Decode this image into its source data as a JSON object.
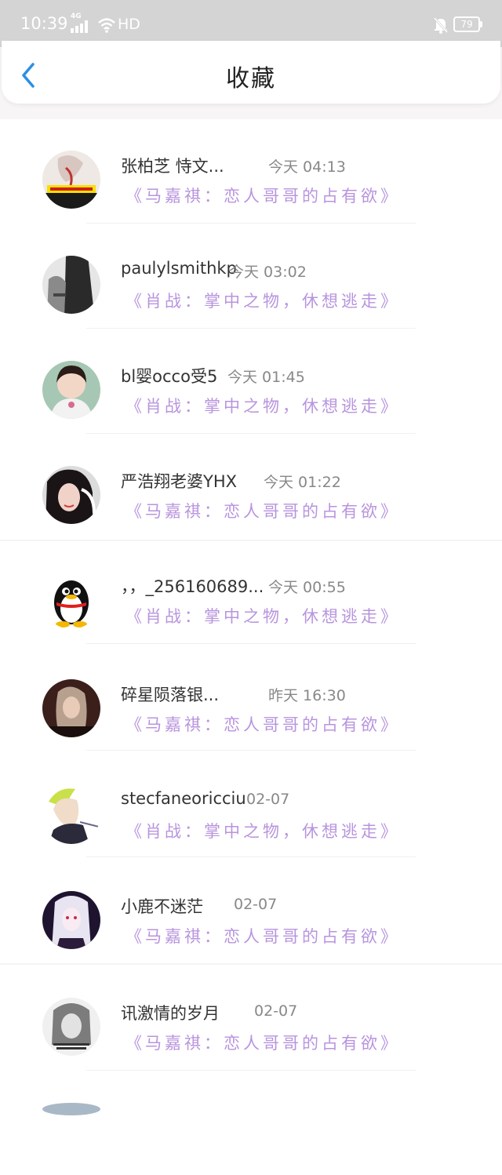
{
  "status": {
    "time": "10:39",
    "network": "4G",
    "hd": "HD",
    "battery": "79"
  },
  "header": {
    "title": "收藏"
  },
  "favorites": [
    {
      "user": "张柏芝 恃文...",
      "time": "今天 04:13",
      "title": "《马嘉祺：恋人哥哥的占有欲》"
    },
    {
      "user": "paulylsmithkp",
      "time": "今天 03:02",
      "title": "《肖战：掌中之物，休想逃走》"
    },
    {
      "user": "bl婴occo受5",
      "time": "今天 01:45",
      "title": "《肖战：掌中之物，休想逃走》"
    },
    {
      "user": "严浩翔老婆YHX",
      "time": "今天 01:22",
      "title": "《马嘉祺：恋人哥哥的占有欲》"
    },
    {
      "user": "，，_256160689...",
      "time": "今天 00:55",
      "title": "《肖战：掌中之物，休想逃走》"
    },
    {
      "user": "碎星陨落银...",
      "time": "昨天 16:30",
      "title": "《马嘉祺：恋人哥哥的占有欲》"
    },
    {
      "user": "stecfaneoricciu",
      "time": "02-07",
      "title": "《肖战：掌中之物，休想逃走》"
    },
    {
      "user": "小鹿不迷茫",
      "time": "02-07",
      "title": "《马嘉祺：恋人哥哥的占有欲》"
    },
    {
      "user": "讯激情的岁月",
      "time": "02-07",
      "title": "《马嘉祺：恋人哥哥的占有欲》"
    }
  ]
}
